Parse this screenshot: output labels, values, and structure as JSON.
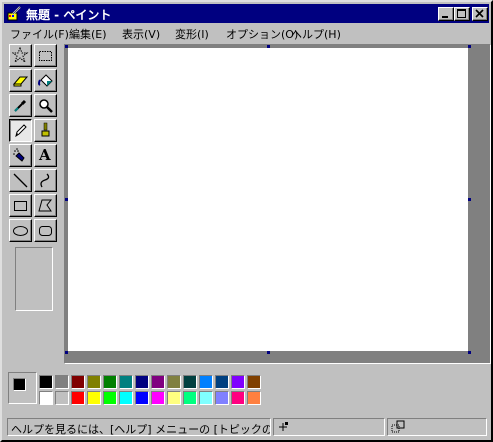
{
  "window": {
    "title": "無題 - ペイント"
  },
  "menu": [
    {
      "label": "ファイル(F)"
    },
    {
      "label": "編集(E)"
    },
    {
      "label": "表示(V)"
    },
    {
      "label": "変形(I)"
    },
    {
      "label": "オプション(O)"
    },
    {
      "label": "ヘルプ(H)"
    }
  ],
  "tools": [
    {
      "name": "free-form-select",
      "icon": "star-select-icon"
    },
    {
      "name": "rect-select",
      "icon": "dotted-rect-icon"
    },
    {
      "name": "eraser",
      "icon": "eraser-icon"
    },
    {
      "name": "fill",
      "icon": "paint-bucket-icon"
    },
    {
      "name": "pick-color",
      "icon": "eyedropper-icon"
    },
    {
      "name": "magnifier",
      "icon": "magnifier-icon"
    },
    {
      "name": "pencil",
      "icon": "pencil-icon",
      "active": true
    },
    {
      "name": "brush",
      "icon": "brush-icon"
    },
    {
      "name": "airbrush",
      "icon": "airbrush-icon"
    },
    {
      "name": "text",
      "icon": "text-a-icon",
      "glyph": "A"
    },
    {
      "name": "line",
      "icon": "line-icon"
    },
    {
      "name": "curve",
      "icon": "curve-icon"
    },
    {
      "name": "rectangle",
      "icon": "rectangle-icon"
    },
    {
      "name": "polygon",
      "icon": "polygon-icon"
    },
    {
      "name": "ellipse",
      "icon": "ellipse-icon"
    },
    {
      "name": "rounded-rectangle",
      "icon": "rounded-rect-icon"
    }
  ],
  "colors": {
    "foreground": "#000000",
    "background": "#ffffff",
    "palette_top": [
      "#000000",
      "#808080",
      "#800000",
      "#808000",
      "#008000",
      "#008080",
      "#000080",
      "#800080",
      "#808040",
      "#004040",
      "#0080ff",
      "#004080",
      "#8000ff",
      "#804000"
    ],
    "palette_bottom": [
      "#ffffff",
      "#c0c0c0",
      "#ff0000",
      "#ffff00",
      "#00ff00",
      "#00ffff",
      "#0000ff",
      "#ff00ff",
      "#ffff80",
      "#00ff80",
      "#80ffff",
      "#8080ff",
      "#ff0080",
      "#ff8040"
    ]
  },
  "status": {
    "help_text": "ヘルプを見るには、[ヘルプ] メニューの [トピックの検索] を選"
  }
}
